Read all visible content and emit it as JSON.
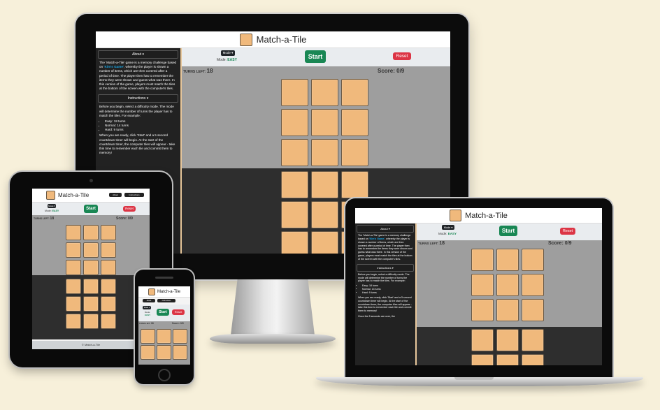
{
  "app": {
    "title": "Match-a-Tile",
    "mode_button": "Mode ▾",
    "mode_prefix": "Mode:",
    "mode_value": "EASY",
    "start_label": "Start",
    "reset_label": "Reset",
    "turns_prefix": "TURNS LEFT:",
    "turns_value": "18",
    "score_label": "Score: 0/9",
    "footer": "© Match-a-Tile",
    "about_heading": "About ▾",
    "instructions_heading": "Instructions ▾",
    "header_about_btn": "About",
    "header_instructions_btn": "Instructions"
  },
  "about": {
    "p1": "The 'Match-a-Tile' game is a memory challenge based on",
    "link": "'Kim's Game'",
    "p2": ", whereby the player is shown a number of items, which are then covered after a period of time. The player then has to remember the items they were shown and guess what was there. In this version of the game, players must match the tiles at the bottom of the screen with the computer's tiles."
  },
  "instructions": {
    "intro": "Before you begin, select a difficulty mode. The mode will determine the number of turns the player has to match the tiles. For example:",
    "easy": "Easy: 18 turns",
    "normal": "Normal: 14 turns",
    "hard": "Hard: 9 turns",
    "step2": "When you are ready, click 'Start' and a 5 second countdown timer will begin. At the start of the countdown timer, the computer tiles will appear - take this time to remember each tile and commit them to memory!",
    "step3": "Once the 5 seconds are over, the"
  },
  "colors": {
    "tile": "#f0b97c",
    "start": "#198754",
    "reset": "#dc3545",
    "board_top": "#9e9e9e",
    "board_bottom": "#2e2e2e",
    "link": "#19a7e6",
    "background": "#f7f0da"
  }
}
